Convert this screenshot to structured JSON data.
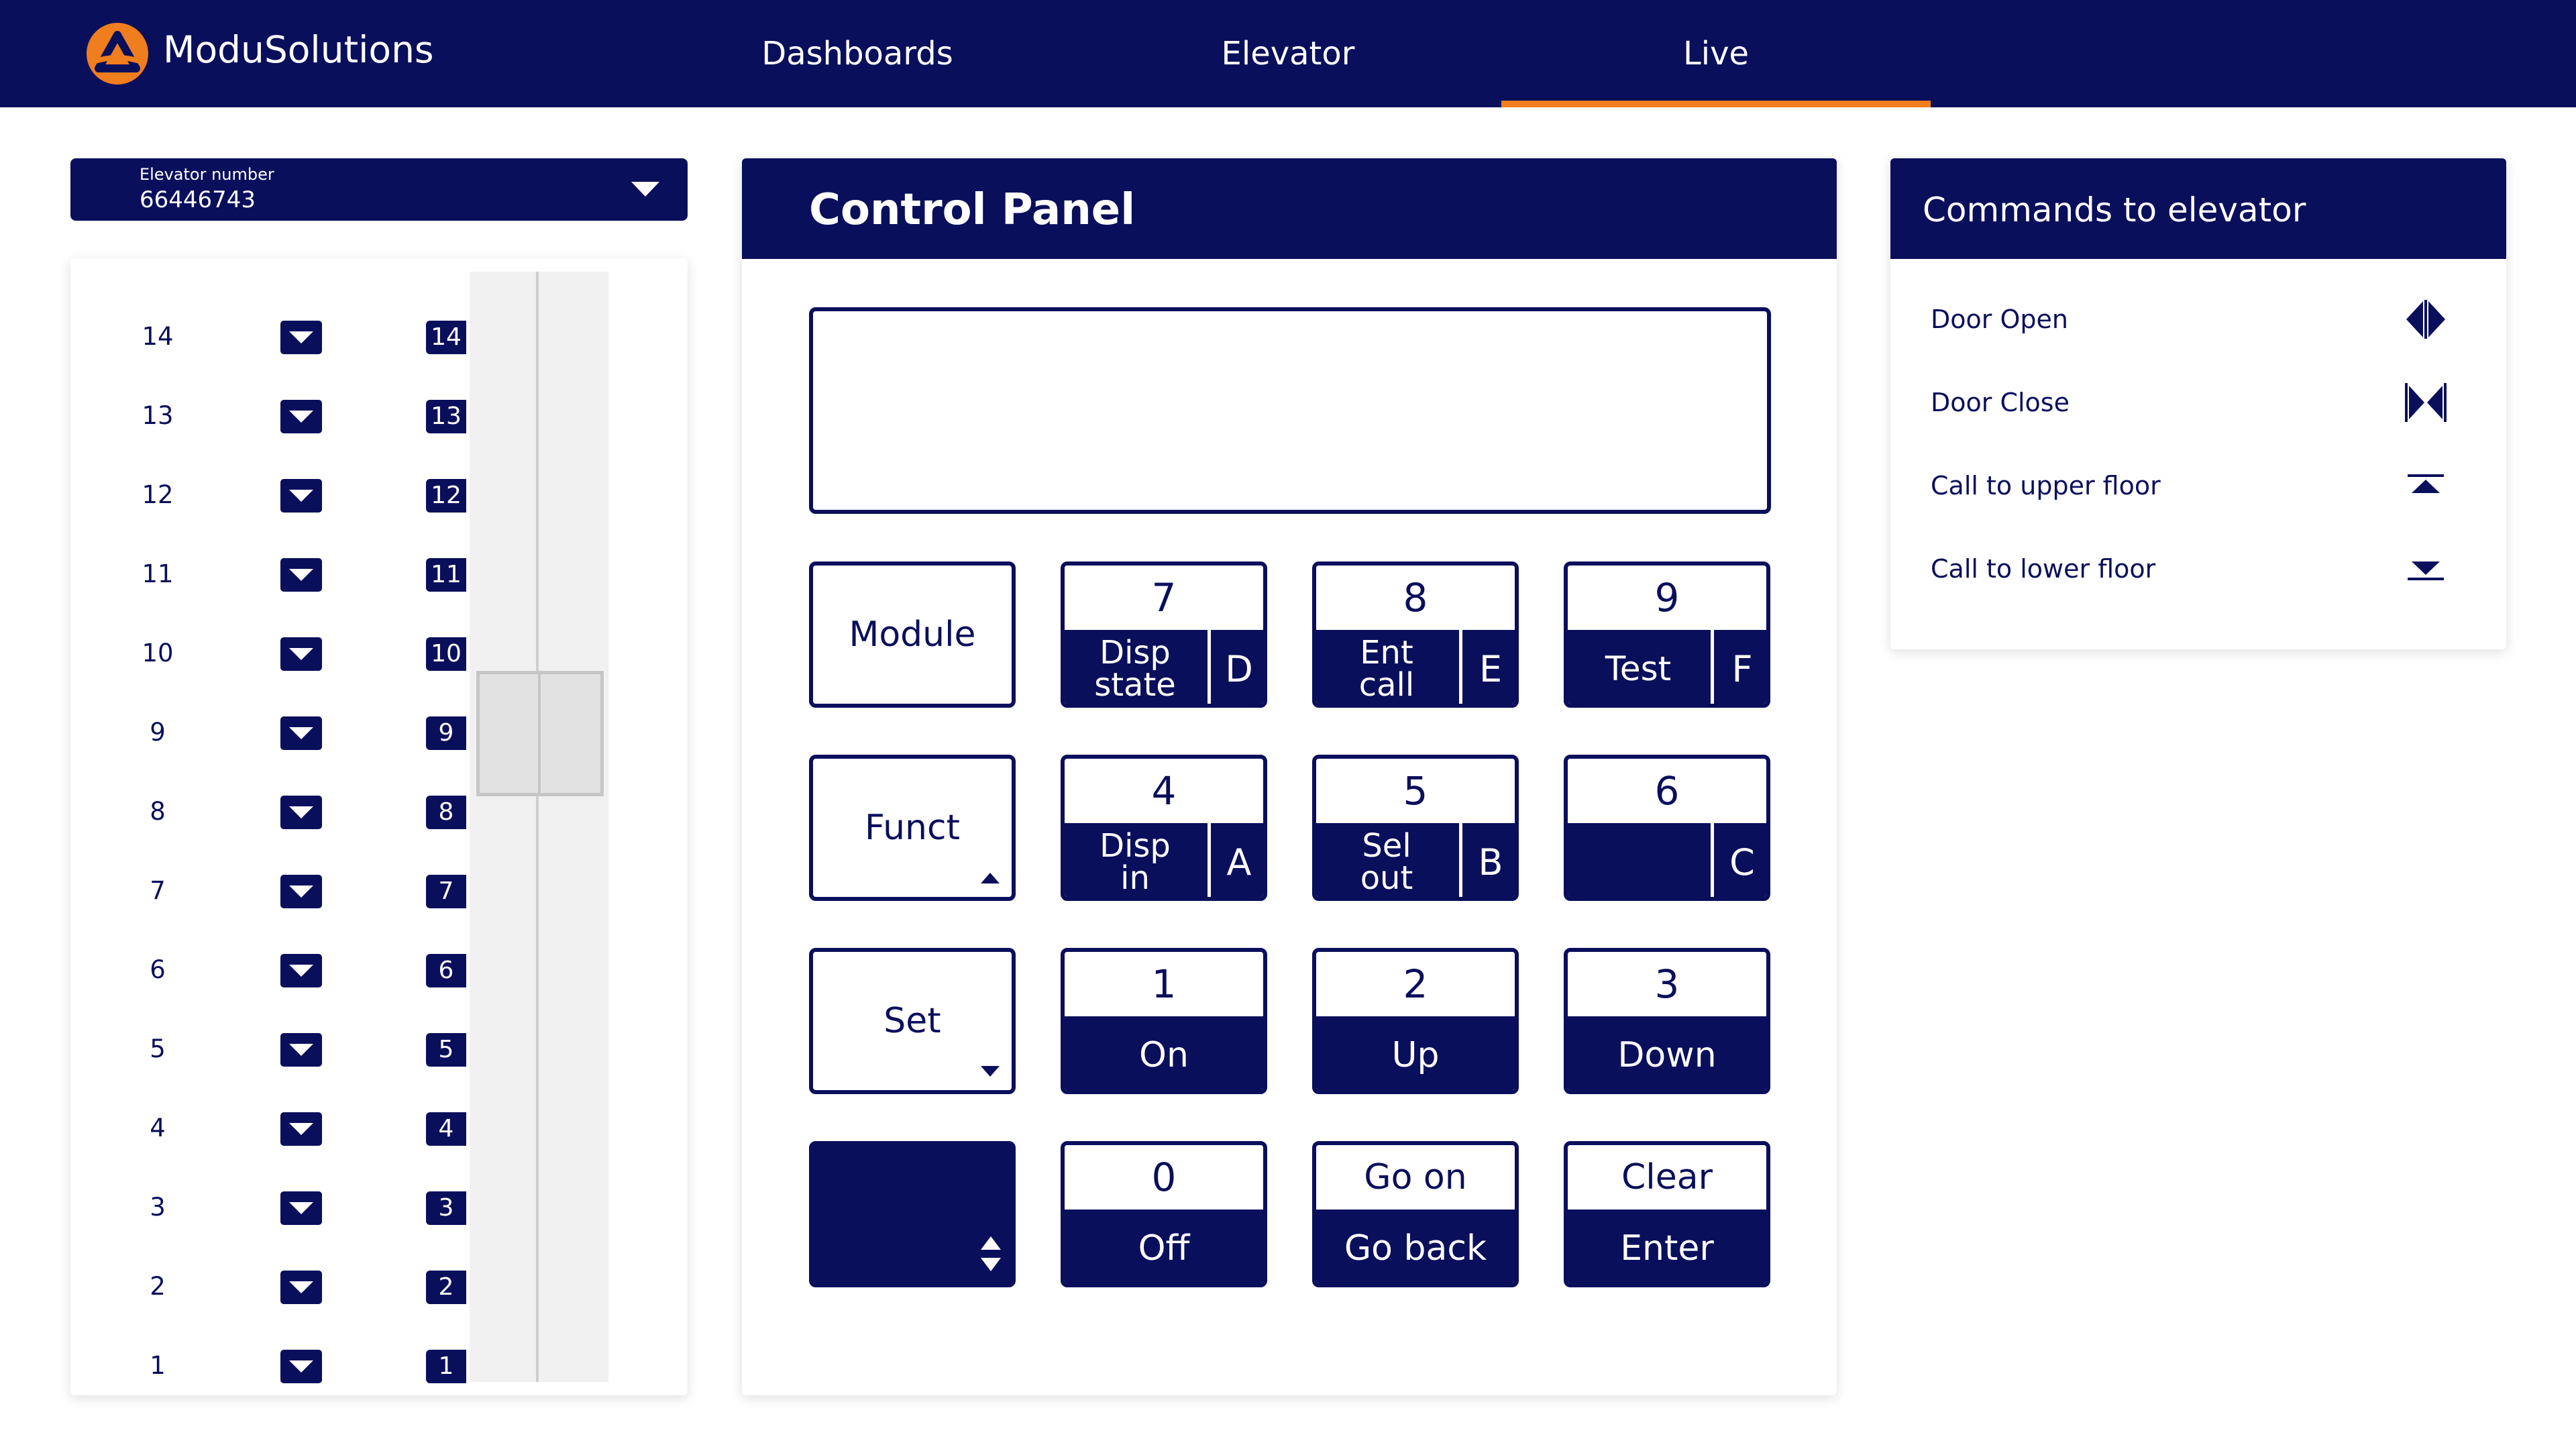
{
  "app": {
    "brand": "ModuSolutions",
    "colors": {
      "navy": "#0a0f5c",
      "accent": "#f07d1e",
      "white": "#ffffff"
    }
  },
  "nav": {
    "items": [
      {
        "label": "Dashboards",
        "active": false
      },
      {
        "label": "Elevator",
        "active": false
      },
      {
        "label": "Live",
        "active": true
      }
    ]
  },
  "elevator_select": {
    "label": "Elevator number",
    "value": "66446743",
    "icon": "chevron-down-icon"
  },
  "floors": {
    "items": [
      "14",
      "13",
      "12",
      "11",
      "10",
      "9",
      "8",
      "7",
      "6",
      "5",
      "4",
      "3",
      "2",
      "1"
    ],
    "current_floor": "9",
    "call_icon": "arrow-down-icon"
  },
  "control_panel": {
    "title": "Control Panel",
    "display_text": "",
    "keys": {
      "module": "Module",
      "funct": "Funct",
      "set": "Set",
      "k7": {
        "top": "7",
        "line1": "Disp",
        "line2": "state",
        "letter": "D"
      },
      "k8": {
        "top": "8",
        "line1": "Ent",
        "line2": "call",
        "letter": "E"
      },
      "k9": {
        "top": "9",
        "line1": "Test",
        "letter": "F"
      },
      "k4": {
        "top": "4",
        "line1": "Disp",
        "line2": "in",
        "letter": "A"
      },
      "k5": {
        "top": "5",
        "line1": "Sel",
        "line2": "out",
        "letter": "B"
      },
      "k6": {
        "top": "6",
        "letter": "C"
      },
      "k1": {
        "top": "1",
        "bottom": "On"
      },
      "k2": {
        "top": "2",
        "bottom": "Up"
      },
      "k3": {
        "top": "3",
        "bottom": "Down"
      },
      "k0": {
        "top": "0",
        "bottom": "Off"
      },
      "go": {
        "top": "Go on",
        "bottom": "Go back"
      },
      "clear": {
        "top": "Clear",
        "bottom": "Enter"
      }
    }
  },
  "commands": {
    "title": "Commands to elevator",
    "items": [
      {
        "label": "Door Open",
        "icon": "door-open-icon"
      },
      {
        "label": "Door Close",
        "icon": "door-close-icon"
      },
      {
        "label": "Call to upper floor",
        "icon": "call-upper-floor-icon"
      },
      {
        "label": "Call to lower floor",
        "icon": "call-lower-floor-icon"
      }
    ]
  }
}
